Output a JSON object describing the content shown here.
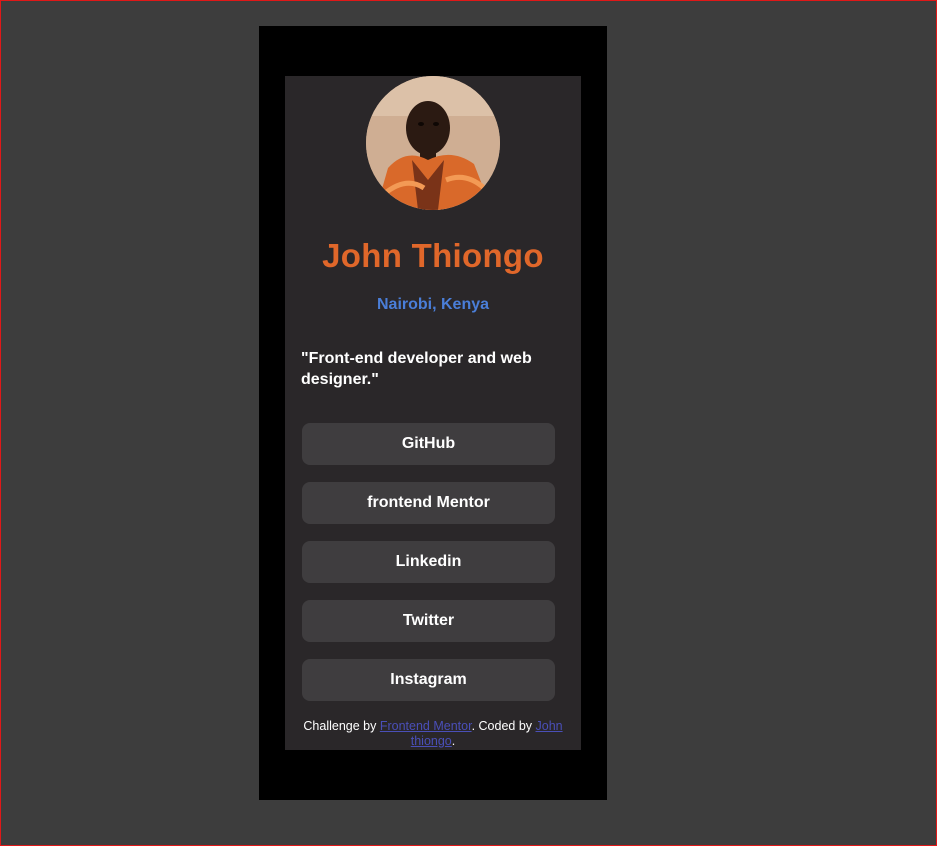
{
  "profile": {
    "name": "John Thiongo",
    "location": "Nairobi, Kenya",
    "bio": "\"Front-end developer and web designer.\""
  },
  "links": [
    {
      "label": "GitHub"
    },
    {
      "label": "frontend Mentor"
    },
    {
      "label": "Linkedin"
    },
    {
      "label": "Twitter"
    },
    {
      "label": "Instagram"
    }
  ],
  "attribution": {
    "prefix": "Challenge by ",
    "challenge_link": "Frontend Mentor",
    "middle": ". Coded by ",
    "author_link": "John thiongo",
    "suffix": "."
  },
  "colors": {
    "page_background": "#3d3d3d",
    "phone_background": "#000000",
    "card_background": "#2a2729",
    "name_color": "#e0672a",
    "location_color": "#4a7ed8",
    "button_background": "#3f3d3f",
    "link_color": "#4a4fb8",
    "viewport_border": "#e01818"
  }
}
